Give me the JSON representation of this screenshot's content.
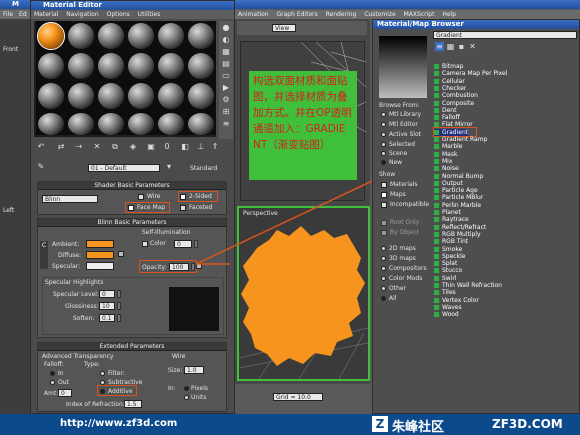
{
  "max_window": {
    "title_letters": "M",
    "menu": [
      "File",
      "Ed"
    ],
    "right_menu": [
      "Animation",
      "Graph Editors",
      "Rendering",
      "Customize",
      "MAXScript",
      "Help"
    ]
  },
  "material_editor": {
    "title": "Material Editor",
    "menu": [
      "Material",
      "Navigation",
      "Options",
      "Utilities"
    ],
    "material_name": "01 - Default",
    "material_type": "Standard",
    "shader_basic": {
      "header": "Shader Basic Parameters",
      "shader": "Blinn",
      "wire": "Wire",
      "two_sided": "2-Sided",
      "face_map": "Face Map",
      "faceted": "Faceted"
    },
    "blinn_basic": {
      "header": "Blinn Basic Parameters",
      "self_illum": "Self-Illumination",
      "color": "Color",
      "color_value": "0",
      "ambient": "Ambient:",
      "diffuse": "Diffuse:",
      "specular": "Specular:",
      "opacity": "Opacity:",
      "opacity_value": "100"
    },
    "spec_highlights": {
      "header": "Specular Highlights",
      "level": "Specular Level:",
      "level_value": "0",
      "gloss": "Glossiness:",
      "gloss_value": "10",
      "soften": "Soften:",
      "soften_value": "0.1"
    },
    "extended": {
      "header": "Extended Parameters",
      "adv_transp": "Advanced Transparency",
      "falloff": "Falloff:",
      "type": "Type:",
      "in": "In",
      "out": "Out",
      "filter": "Filter:",
      "subtractive": "Subtractive",
      "additive": "Additive",
      "amt": "Amt:",
      "amt_value": "0",
      "ior": "Index of Refraction:",
      "ior_value": "1.5",
      "wire": "Wire",
      "size": "Size:",
      "size_value": "1.0",
      "in2": "In:",
      "pixels": "Pixels",
      "units": "Units"
    }
  },
  "annotation": {
    "text": "构选双面材质和面贴图，并选择材质为叠加方式。并在OP透明通道加入：GRADIENT（渐变贴图）"
  },
  "viewports": {
    "view_label": "View",
    "front_label": "Front",
    "left_label": "Left",
    "perspective_label": "Perspective",
    "grid_label": "Grid = 10.0"
  },
  "browser": {
    "title": "Material/Map Browser",
    "search_value": "Gradient",
    "browse_from": "Browse From:",
    "sources": [
      "Mtl Library",
      "Mtl Editor",
      "Active Slot",
      "Selected",
      "Scene",
      "New"
    ],
    "show": "Show",
    "show_items": [
      "Materials",
      "Maps",
      "Incompatible"
    ],
    "show_sub": [
      "Root Only",
      "By Object"
    ],
    "map_types": [
      "2D maps",
      "3D maps",
      "Compositors",
      "Color Mods",
      "Other",
      "All"
    ],
    "maps": [
      "Bitmap",
      "Camera Map Per Pixel",
      "Cellular",
      "Checker",
      "Combustion",
      "Composite",
      "Dent",
      "Falloff",
      "Flat Mirror",
      "Gradient",
      "Gradient Ramp",
      "Marble",
      "Mask",
      "Mix",
      "Noise",
      "Normal Bump",
      "Output",
      "Particle Age",
      "Particle MBlur",
      "Perlin Marble",
      "Planet",
      "Raytrace",
      "Reflect/Refract",
      "RGB Multiply",
      "RGB Tint",
      "Smoke",
      "Speckle",
      "Splat",
      "Stucco",
      "Swirl",
      "Thin Wall Refraction",
      "Tiles",
      "Vertex Color",
      "Waves",
      "Wood"
    ]
  },
  "footer": {
    "url": "http://www.zf3d.com",
    "brand": "朱峰社区",
    "domain": "ZF3D.COM"
  },
  "colors": {
    "accent": "#f7941d",
    "highlight": "#d8541e",
    "note_bg": "#3fbf3a",
    "note_text": "#d81e1e"
  }
}
